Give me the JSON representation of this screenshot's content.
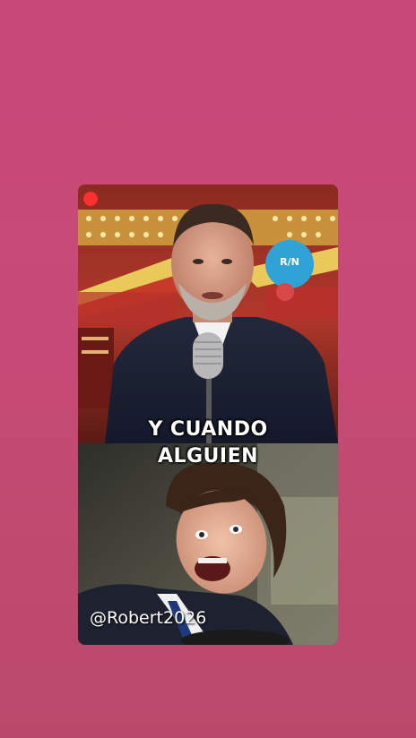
{
  "story": {
    "caption_line1": "Y CUANDO",
    "caption_line2": "ALGUIEN",
    "watermark": "@Robert2026",
    "channel_logo": "R/N"
  },
  "colors": {
    "background": "#c9487a",
    "caption_text": "#ffffff"
  }
}
